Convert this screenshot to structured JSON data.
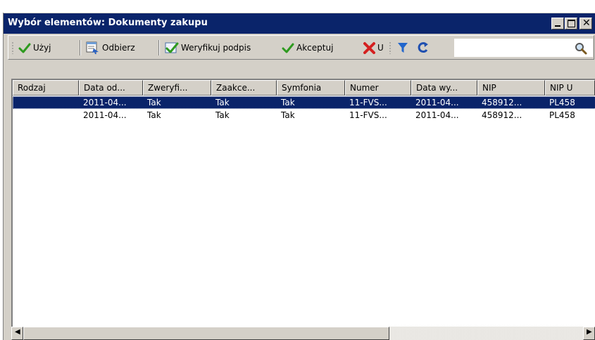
{
  "window": {
    "title": "Wybór elementów: Dokumenty zakupu"
  },
  "toolbar": {
    "use_label": "Użyj",
    "receive_label": "Odbierz",
    "verify_label": "Weryfikuj podpis",
    "accept_label": "Akceptuj",
    "delete_label": "U",
    "search_value": ""
  },
  "table": {
    "columns": [
      "Rodzaj",
      "Data od...",
      "Zweryfi...",
      "Zaakce...",
      "Symfonia",
      "Numer",
      "Data wy...",
      "NIP",
      "NIP U"
    ],
    "rows": [
      [
        "",
        "2011-04...",
        "Tak",
        "Tak",
        "Tak",
        "11-FVS...",
        "2011-04...",
        "458912...",
        "PL458"
      ],
      [
        "",
        "2011-04...",
        "Tak",
        "Tak",
        "Tak",
        "11-FVS...",
        "2011-04...",
        "458912...",
        "PL458"
      ]
    ],
    "selected_row": 0
  },
  "icons": {
    "use": "check-icon",
    "receive": "receive-icon",
    "verify": "verify-signature-icon",
    "accept": "check-icon",
    "delete": "delete-icon",
    "filter": "filter-icon",
    "refresh": "refresh-icon",
    "search": "search-icon"
  },
  "colors": {
    "title_bar": "#0a246a",
    "selection": "#0a246a",
    "check_green": "#2e9a1f",
    "delete_red": "#d42020",
    "filter_blue": "#2266cc"
  }
}
